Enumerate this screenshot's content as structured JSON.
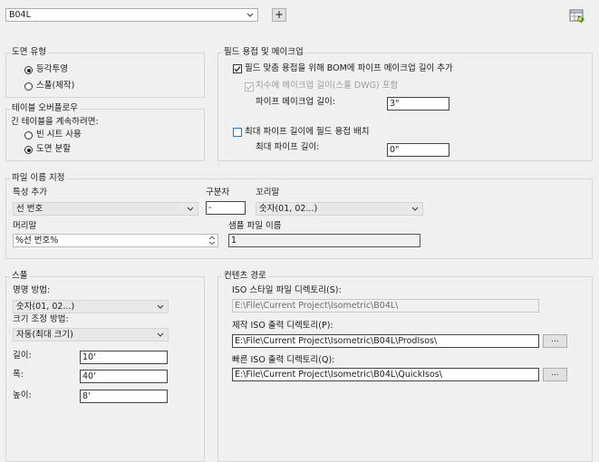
{
  "top": {
    "drawing_select": "B04L",
    "add_label": "+",
    "icon": "table-settings-icon"
  },
  "drawing_type": {
    "title": "도면 유형",
    "options": [
      "등각투영",
      "스풀(제작)"
    ],
    "selected": 0
  },
  "table_overflow": {
    "title": "테이블 오버플로우",
    "prompt": "긴 테이블을 계속하려면:",
    "options": [
      "빈 시트 사용",
      "도면 분할"
    ],
    "selected": 1
  },
  "field_weld": {
    "title": "필드 용접 및 메이크업",
    "add_makeup_label": "필드 맞춤 용접을 위해 BOM에 파이프 메이크업 길이 추가",
    "add_makeup_checked": true,
    "include_dim_label": "치수에 메이크업 길이(스풀 DWG) 포함",
    "include_dim_checked": true,
    "makeup_length_label": "파이프 메이크업 길이:",
    "makeup_length_value": "3\"",
    "max_length_check_label": "최대 파이프 길이에 필드 용접 배치",
    "max_length_checked": false,
    "max_length_label": "최대 파이프 길이:",
    "max_length_value": "0\""
  },
  "file_naming": {
    "title": "파일 이름 지정",
    "add_property_label": "특성 추가",
    "add_property_value": "선 번호",
    "separator_label": "구분자",
    "separator_value": "-",
    "suffix_label": "꼬리말",
    "suffix_value": "숫자(01, 02...)",
    "prefix_label": "머리말",
    "prefix_value": "%선 번호%",
    "sample_label": "샘플 파일 이름",
    "sample_value": "1"
  },
  "spool": {
    "title": "스풀",
    "naming_label": "명명 방법:",
    "naming_value": "숫자(01, 02...)",
    "sizing_label": "크기 조정 방법:",
    "sizing_value": "자동(최대 크기)",
    "length_label": "길이:",
    "length_value": "10'",
    "width_label": "폭:",
    "width_value": "40'",
    "height_label": "높이:",
    "height_value": "8'"
  },
  "content_paths": {
    "title": "컨텐츠 경로",
    "iso_style_label": "ISO 스타일 파일 디렉토리(S):",
    "iso_style_value": "E:\\File\\Current Project\\Isometric\\B04L\\",
    "prod_label": "제작 ISO 출력 디렉토리(P):",
    "prod_value": "E:\\File\\Current Project\\Isometric\\B04L\\ProdIsos\\",
    "quick_label": "빠른 ISO 출력 디렉토리(Q):",
    "quick_value": "E:\\File\\Current Project\\Isometric\\B04L\\QuickIsos\\",
    "browse_label": "..."
  }
}
